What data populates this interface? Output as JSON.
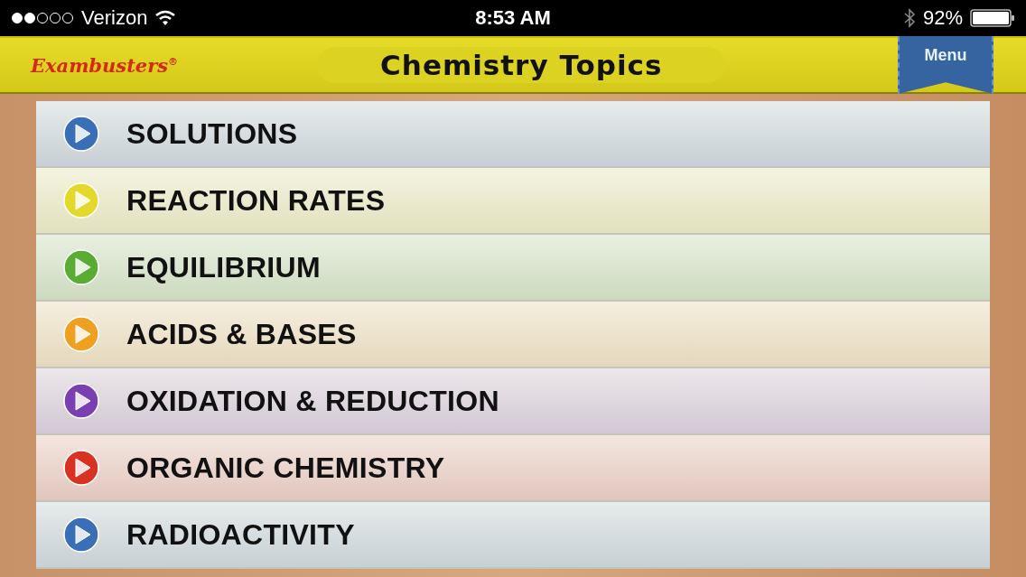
{
  "status_bar": {
    "carrier": "Verizon",
    "time": "8:53 AM",
    "battery": "92%"
  },
  "header": {
    "logo": "Exambusters",
    "logo_mark": "®",
    "title": "Chemistry Topics",
    "menu_button": "Menu"
  },
  "topics": [
    {
      "label": "SOLUTIONS",
      "color": "#3a6fb8"
    },
    {
      "label": "REACTION RATES",
      "color": "#e2d92a"
    },
    {
      "label": "EQUILIBRIUM",
      "color": "#5aac32"
    },
    {
      "label": "ACIDS & BASES",
      "color": "#f0a020"
    },
    {
      "label": "OXIDATION & REDUCTION",
      "color": "#7a3fb0"
    },
    {
      "label": "ORGANIC CHEMISTRY",
      "color": "#d83222"
    },
    {
      "label": "RADIOACTIVITY",
      "color": "#3a6fb8"
    }
  ]
}
